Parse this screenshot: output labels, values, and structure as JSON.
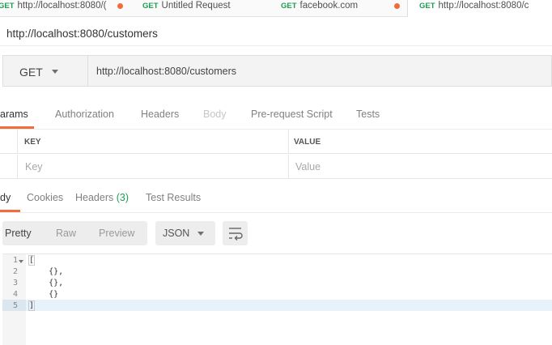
{
  "tabs": [
    {
      "method": "GET",
      "label": "http://localhost:8080/(",
      "dirty": true
    },
    {
      "method": "GET",
      "label": "Untitled Request",
      "dirty": false
    },
    {
      "method": "GET",
      "label": "facebook.com",
      "dirty": true
    },
    {
      "method": "GET",
      "label": "http://localhost:8080/c",
      "dirty": true,
      "active": true
    }
  ],
  "request": {
    "title": "http://localhost:8080/customers",
    "method": "GET",
    "url": "http://localhost:8080/customers"
  },
  "request_tabs": [
    "arams",
    "Authorization",
    "Headers",
    "Body",
    "Pre-request Script",
    "Tests"
  ],
  "params_table": {
    "headers": [
      "KEY",
      "VALUE"
    ],
    "placeholders": [
      "Key",
      "Value"
    ]
  },
  "response_tabs": {
    "body": "dy",
    "cookies": "Cookies",
    "headers": "Headers",
    "headers_count": "(3)",
    "test_results": "Test Results"
  },
  "toolbar": {
    "formats": [
      "Pretty",
      "Raw",
      "Preview"
    ],
    "language": "JSON"
  },
  "editor": {
    "line_numbers": [
      "1",
      "2",
      "3",
      "4",
      "5"
    ],
    "lines": [
      "[",
      "    {},",
      "    {},",
      "    {}",
      "]"
    ]
  },
  "colors": {
    "accent": "#f26b3a",
    "method_green": "#1f9d55"
  },
  "icons": {
    "method_caret": "chevron-down-icon",
    "language_caret": "chevron-down-icon",
    "wrap": "wrap-lines-icon"
  }
}
